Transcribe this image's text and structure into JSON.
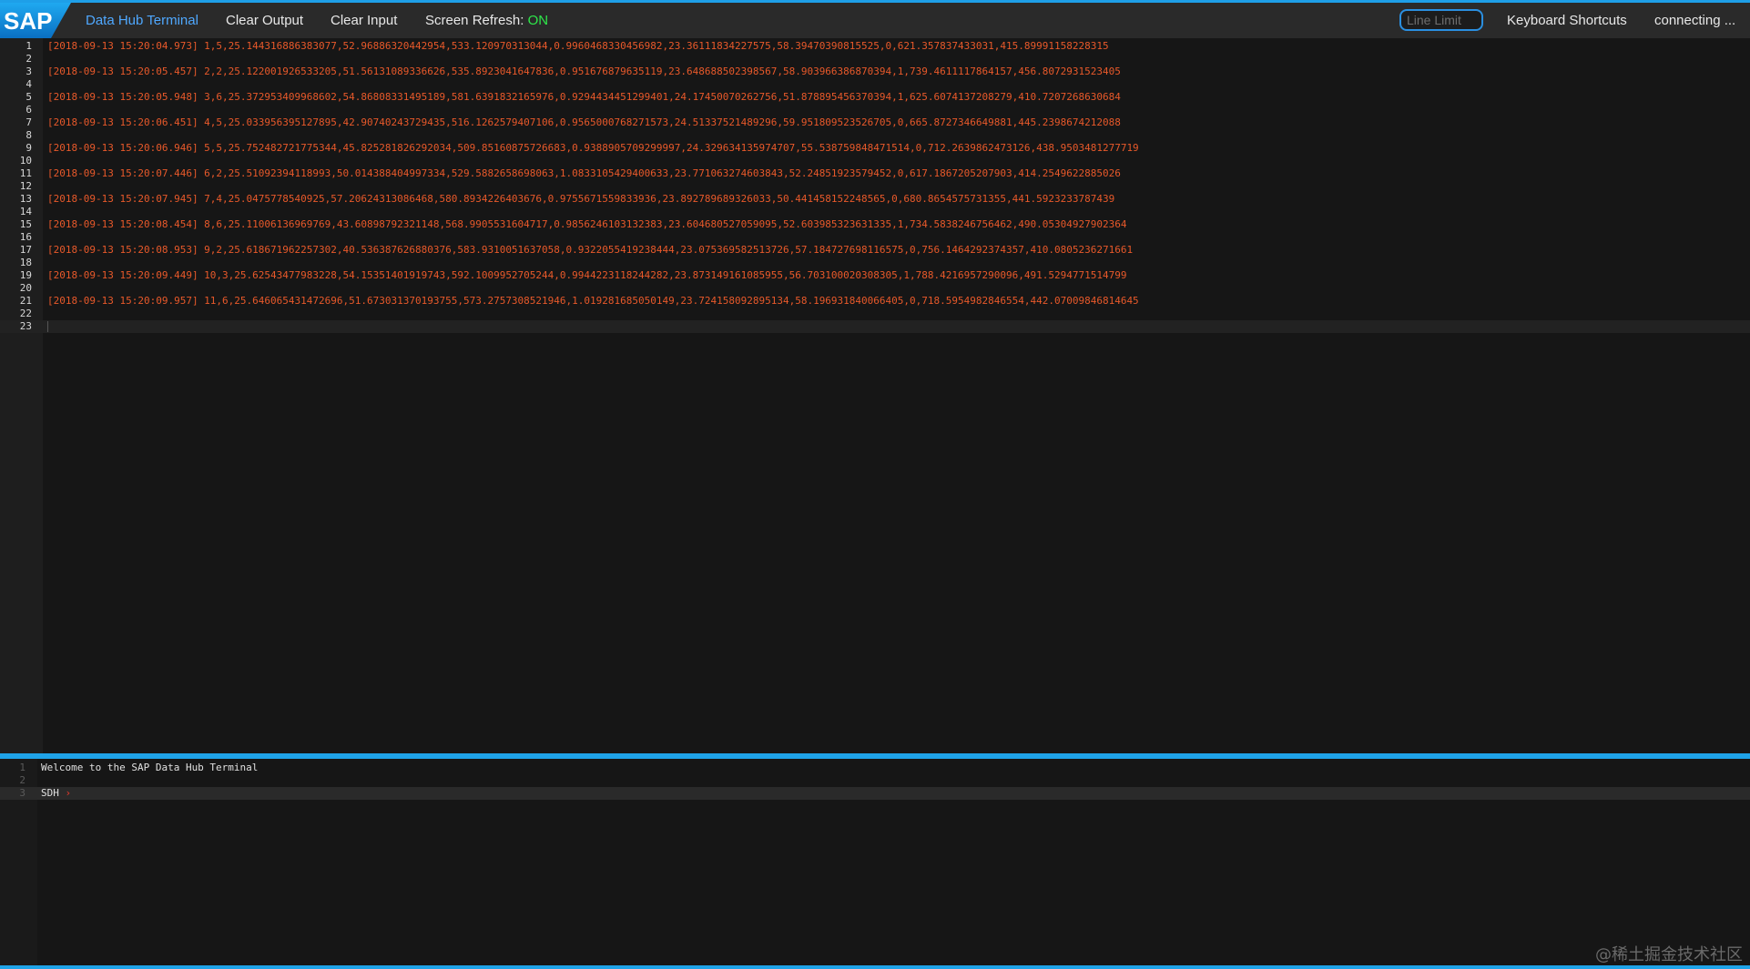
{
  "header": {
    "logo_text": "SAP",
    "nav": {
      "terminal": "Data Hub Terminal",
      "clear_output": "Clear Output",
      "clear_input": "Clear Input",
      "screen_refresh_label": "Screen Refresh: ",
      "screen_refresh_state": "ON"
    },
    "line_limit_placeholder": "Line Limit",
    "keyboard_shortcuts": "Keyboard Shortcuts",
    "status": "connecting ..."
  },
  "output": {
    "line_numbers": [
      "1",
      "2",
      "3",
      "4",
      "5",
      "6",
      "7",
      "8",
      "9",
      "10",
      "11",
      "12",
      "13",
      "14",
      "15",
      "16",
      "17",
      "18",
      "19",
      "20",
      "21",
      "22",
      "23"
    ],
    "lines": [
      "[2018-09-13 15:20:04.973] 1,5,25.144316886383077,52.96886320442954,533.120970313044,0.9960468330456982,23.36111834227575,58.39470390815525,0,621.357837433031,415.89991158228315",
      "",
      "[2018-09-13 15:20:05.457] 2,2,25.122001926533205,51.56131089336626,535.8923041647836,0.951676879635119,23.648688502398567,58.903966386870394,1,739.4611117864157,456.8072931523405",
      "",
      "[2018-09-13 15:20:05.948] 3,6,25.372953409968602,54.86808331495189,581.6391832165976,0.9294434451299401,24.17450070262756,51.878895456370394,1,625.6074137208279,410.7207268630684",
      "",
      "[2018-09-13 15:20:06.451] 4,5,25.033956395127895,42.90740243729435,516.1262579407106,0.9565000768271573,24.51337521489296,59.951809523526705,0,665.8727346649881,445.2398674212088",
      "",
      "[2018-09-13 15:20:06.946] 5,5,25.752482721775344,45.825281826292034,509.85160875726683,0.9388905709299997,24.329634135974707,55.538759848471514,0,712.2639862473126,438.9503481277719",
      "",
      "[2018-09-13 15:20:07.446] 6,2,25.51092394118993,50.014388404997334,529.5882658698063,1.0833105429400633,23.771063274603843,52.24851923579452,0,617.1867205207903,414.2549622885026",
      "",
      "[2018-09-13 15:20:07.945] 7,4,25.0475778540925,57.20624313086468,580.8934226403676,0.9755671559833936,23.892789689326033,50.441458152248565,0,680.8654575731355,441.5923233787439",
      "",
      "[2018-09-13 15:20:08.454] 8,6,25.11006136969769,43.60898792321148,568.9905531604717,0.9856246103132383,23.604680527059095,52.603985323631335,1,734.5838246756462,490.05304927902364",
      "",
      "[2018-09-13 15:20:08.953] 9,2,25.618671962257302,40.536387626880376,583.9310051637058,0.9322055419238444,23.075369582513726,57.184727698116575,0,756.1464292374357,410.0805236271661",
      "",
      "[2018-09-13 15:20:09.449] 10,3,25.62543477983228,54.15351401919743,592.1009952705244,0.9944223118244282,23.873149161085955,56.703100020308305,1,788.4216957290096,491.5294771514799",
      "",
      "[2018-09-13 15:20:09.957] 11,6,25.646065431472696,51.673031370193755,573.2757308521946,1.019281685050149,23.724158092895134,58.196931840066405,0,718.5954982846554,442.07009846814645",
      "",
      ""
    ]
  },
  "input": {
    "line_numbers": [
      "1",
      "2",
      "3"
    ],
    "welcome": "Welcome to the SAP Data Hub Terminal",
    "prompt_label": "SDH ",
    "prompt_arrow": "›"
  },
  "watermark": "@稀土掘金技术社区"
}
